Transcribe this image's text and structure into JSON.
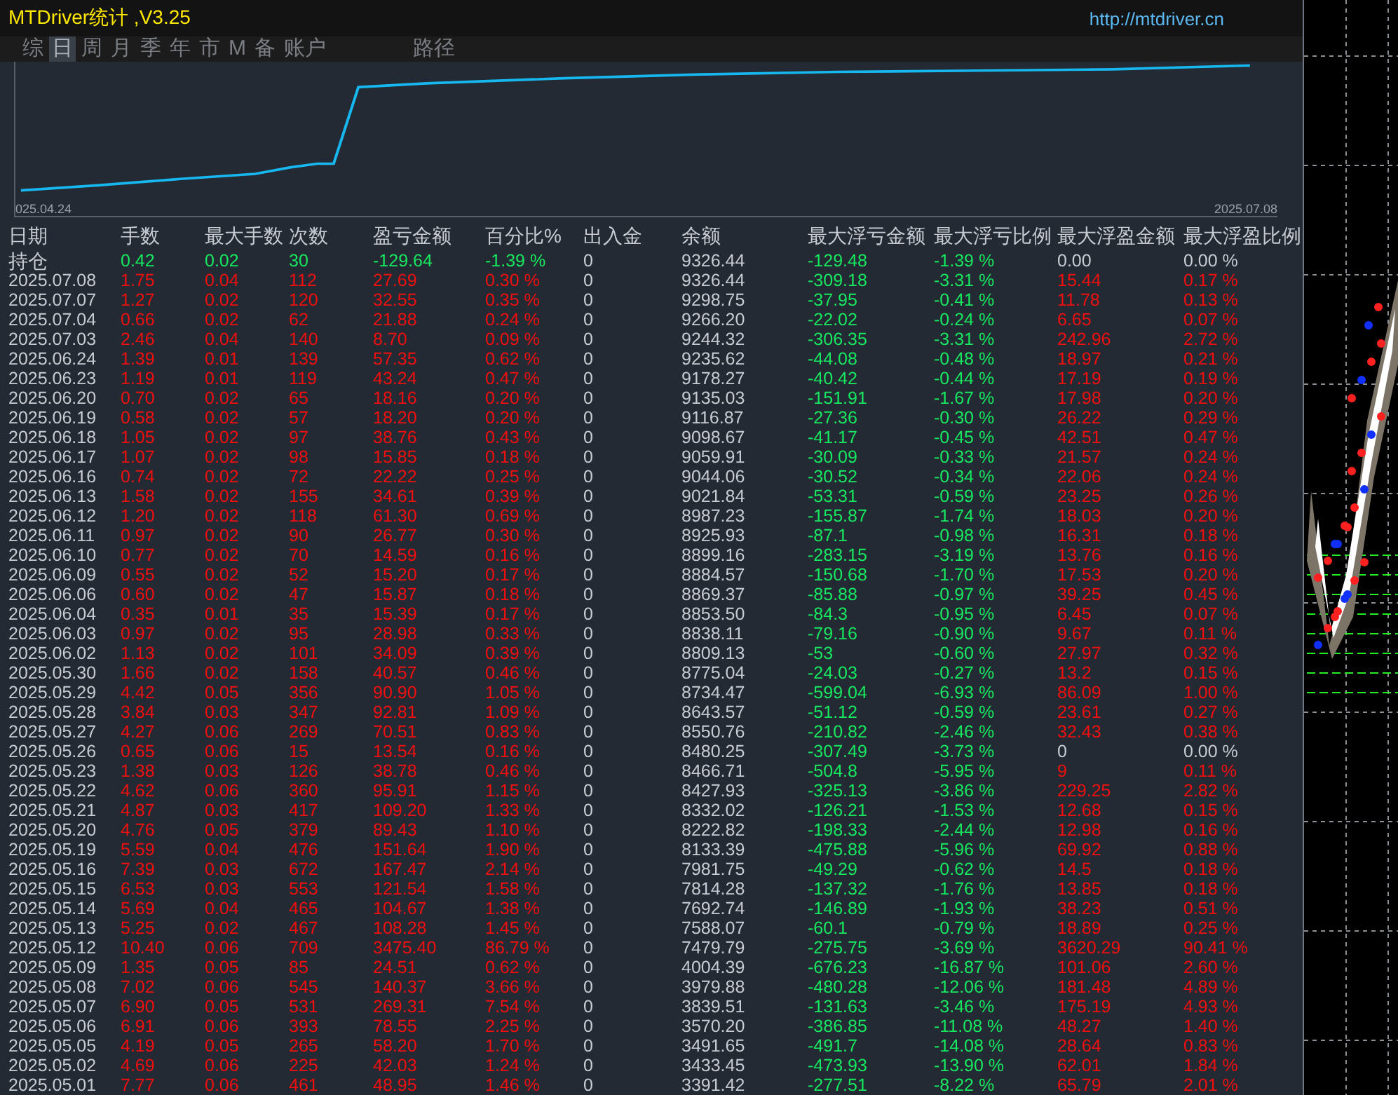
{
  "title": "MTDriver统计 ,V3.25",
  "url": "http://mtdriver.cn",
  "tabs": [
    {
      "label": "综",
      "selected": false
    },
    {
      "label": "日",
      "selected": true
    },
    {
      "label": "周",
      "selected": false
    },
    {
      "label": "月",
      "selected": false
    },
    {
      "label": "季",
      "selected": false
    },
    {
      "label": "年",
      "selected": false
    },
    {
      "label": "市",
      "selected": false
    },
    {
      "label": "M",
      "selected": false
    },
    {
      "label": "备",
      "selected": false
    },
    {
      "label": "账户",
      "selected": false
    },
    {
      "label": "路径",
      "selected": false
    }
  ],
  "equity_chart": {
    "start_label": "025.04.24",
    "end_label": "2025.07.08"
  },
  "columns": [
    "日期",
    "手数",
    "最大手数",
    "次数",
    "盈亏金额",
    "百分比%",
    "出入金",
    "余额",
    "最大浮亏金额",
    "最大浮亏比例",
    "最大浮盈金额",
    "最大浮盈比例"
  ],
  "rows": [
    {
      "kind": "holding",
      "date": "持仓",
      "values": [
        "0.42",
        "0.02",
        "30",
        "-129.64",
        "-1.39 %",
        "0",
        "9326.44",
        "-129.48",
        "-1.39 %",
        "0.00",
        "0.00 %"
      ],
      "zero_float_profit": true
    },
    {
      "kind": "day",
      "date": "2025.07.08",
      "values": [
        "1.75",
        "0.04",
        "112",
        "27.69",
        "0.30 %",
        "0",
        "9326.44",
        "-309.18",
        "-3.31 %",
        "15.44",
        "0.17 %"
      ],
      "zero_float_profit": false
    },
    {
      "kind": "day",
      "date": "2025.07.07",
      "values": [
        "1.27",
        "0.02",
        "120",
        "32.55",
        "0.35 %",
        "0",
        "9298.75",
        "-37.95",
        "-0.41 %",
        "11.78",
        "0.13 %"
      ],
      "zero_float_profit": false
    },
    {
      "kind": "day",
      "date": "2025.07.04",
      "values": [
        "0.66",
        "0.02",
        "62",
        "21.88",
        "0.24 %",
        "0",
        "9266.20",
        "-22.02",
        "-0.24 %",
        "6.65",
        "0.07 %"
      ],
      "zero_float_profit": false
    },
    {
      "kind": "day",
      "date": "2025.07.03",
      "values": [
        "2.46",
        "0.04",
        "140",
        "8.70",
        "0.09 %",
        "0",
        "9244.32",
        "-306.35",
        "-3.31 %",
        "242.96",
        "2.72 %"
      ],
      "zero_float_profit": false
    },
    {
      "kind": "day",
      "date": "2025.06.24",
      "values": [
        "1.39",
        "0.01",
        "139",
        "57.35",
        "0.62 %",
        "0",
        "9235.62",
        "-44.08",
        "-0.48 %",
        "18.97",
        "0.21 %"
      ],
      "zero_float_profit": false
    },
    {
      "kind": "day",
      "date": "2025.06.23",
      "values": [
        "1.19",
        "0.01",
        "119",
        "43.24",
        "0.47 %",
        "0",
        "9178.27",
        "-40.42",
        "-0.44 %",
        "17.19",
        "0.19 %"
      ],
      "zero_float_profit": false
    },
    {
      "kind": "day",
      "date": "2025.06.20",
      "values": [
        "0.70",
        "0.02",
        "65",
        "18.16",
        "0.20 %",
        "0",
        "9135.03",
        "-151.91",
        "-1.67 %",
        "17.98",
        "0.20 %"
      ],
      "zero_float_profit": false
    },
    {
      "kind": "day",
      "date": "2025.06.19",
      "values": [
        "0.58",
        "0.02",
        "57",
        "18.20",
        "0.20 %",
        "0",
        "9116.87",
        "-27.36",
        "-0.30 %",
        "26.22",
        "0.29 %"
      ],
      "zero_float_profit": false
    },
    {
      "kind": "day",
      "date": "2025.06.18",
      "values": [
        "1.05",
        "0.02",
        "97",
        "38.76",
        "0.43 %",
        "0",
        "9098.67",
        "-41.17",
        "-0.45 %",
        "42.51",
        "0.47 %"
      ],
      "zero_float_profit": false
    },
    {
      "kind": "day",
      "date": "2025.06.17",
      "values": [
        "1.07",
        "0.02",
        "98",
        "15.85",
        "0.18 %",
        "0",
        "9059.91",
        "-30.09",
        "-0.33 %",
        "21.57",
        "0.24 %"
      ],
      "zero_float_profit": false
    },
    {
      "kind": "day",
      "date": "2025.06.16",
      "values": [
        "0.74",
        "0.02",
        "72",
        "22.22",
        "0.25 %",
        "0",
        "9044.06",
        "-30.52",
        "-0.34 %",
        "22.06",
        "0.24 %"
      ],
      "zero_float_profit": false
    },
    {
      "kind": "day",
      "date": "2025.06.13",
      "values": [
        "1.58",
        "0.02",
        "155",
        "34.61",
        "0.39 %",
        "0",
        "9021.84",
        "-53.31",
        "-0.59 %",
        "23.25",
        "0.26 %"
      ],
      "zero_float_profit": false
    },
    {
      "kind": "day",
      "date": "2025.06.12",
      "values": [
        "1.20",
        "0.02",
        "118",
        "61.30",
        "0.69 %",
        "0",
        "8987.23",
        "-155.87",
        "-1.74 %",
        "18.03",
        "0.20 %"
      ],
      "zero_float_profit": false
    },
    {
      "kind": "day",
      "date": "2025.06.11",
      "values": [
        "0.97",
        "0.02",
        "90",
        "26.77",
        "0.30 %",
        "0",
        "8925.93",
        "-87.1",
        "-0.98 %",
        "16.31",
        "0.18 %"
      ],
      "zero_float_profit": false
    },
    {
      "kind": "day",
      "date": "2025.06.10",
      "values": [
        "0.77",
        "0.02",
        "70",
        "14.59",
        "0.16 %",
        "0",
        "8899.16",
        "-283.15",
        "-3.19 %",
        "13.76",
        "0.16 %"
      ],
      "zero_float_profit": false
    },
    {
      "kind": "day",
      "date": "2025.06.09",
      "values": [
        "0.55",
        "0.02",
        "52",
        "15.20",
        "0.17 %",
        "0",
        "8884.57",
        "-150.68",
        "-1.70 %",
        "17.53",
        "0.20 %"
      ],
      "zero_float_profit": false
    },
    {
      "kind": "day",
      "date": "2025.06.06",
      "values": [
        "0.60",
        "0.02",
        "47",
        "15.87",
        "0.18 %",
        "0",
        "8869.37",
        "-85.88",
        "-0.97 %",
        "39.25",
        "0.45 %"
      ],
      "zero_float_profit": false
    },
    {
      "kind": "day",
      "date": "2025.06.04",
      "values": [
        "0.35",
        "0.01",
        "35",
        "15.39",
        "0.17 %",
        "0",
        "8853.50",
        "-84.3",
        "-0.95 %",
        "6.45",
        "0.07 %"
      ],
      "zero_float_profit": false
    },
    {
      "kind": "day",
      "date": "2025.06.03",
      "values": [
        "0.97",
        "0.02",
        "95",
        "28.98",
        "0.33 %",
        "0",
        "8838.11",
        "-79.16",
        "-0.90 %",
        "9.67",
        "0.11 %"
      ],
      "zero_float_profit": false
    },
    {
      "kind": "day",
      "date": "2025.06.02",
      "values": [
        "1.13",
        "0.02",
        "101",
        "34.09",
        "0.39 %",
        "0",
        "8809.13",
        "-53",
        "-0.60 %",
        "27.97",
        "0.32 %"
      ],
      "zero_float_profit": false
    },
    {
      "kind": "day",
      "date": "2025.05.30",
      "values": [
        "1.66",
        "0.02",
        "158",
        "40.57",
        "0.46 %",
        "0",
        "8775.04",
        "-24.03",
        "-0.27 %",
        "13.2",
        "0.15 %"
      ],
      "zero_float_profit": false
    },
    {
      "kind": "day",
      "date": "2025.05.29",
      "values": [
        "4.42",
        "0.05",
        "356",
        "90.90",
        "1.05 %",
        "0",
        "8734.47",
        "-599.04",
        "-6.93 %",
        "86.09",
        "1.00 %"
      ],
      "zero_float_profit": false
    },
    {
      "kind": "day",
      "date": "2025.05.28",
      "values": [
        "3.84",
        "0.03",
        "347",
        "92.81",
        "1.09 %",
        "0",
        "8643.57",
        "-51.12",
        "-0.59 %",
        "23.61",
        "0.27 %"
      ],
      "zero_float_profit": false
    },
    {
      "kind": "day",
      "date": "2025.05.27",
      "values": [
        "4.27",
        "0.06",
        "269",
        "70.51",
        "0.83 %",
        "0",
        "8550.76",
        "-210.82",
        "-2.46 %",
        "32.43",
        "0.38 %"
      ],
      "zero_float_profit": false
    },
    {
      "kind": "day",
      "date": "2025.05.26",
      "values": [
        "0.65",
        "0.06",
        "15",
        "13.54",
        "0.16 %",
        "0",
        "8480.25",
        "-307.49",
        "-3.73 %",
        "0",
        "0.00 %"
      ],
      "zero_float_profit": true
    },
    {
      "kind": "day",
      "date": "2025.05.23",
      "values": [
        "1.38",
        "0.03",
        "126",
        "38.78",
        "0.46 %",
        "0",
        "8466.71",
        "-504.8",
        "-5.95 %",
        "9",
        "0.11 %"
      ],
      "zero_float_profit": false
    },
    {
      "kind": "day",
      "date": "2025.05.22",
      "values": [
        "4.62",
        "0.06",
        "360",
        "95.91",
        "1.15 %",
        "0",
        "8427.93",
        "-325.13",
        "-3.86 %",
        "229.25",
        "2.82 %"
      ],
      "zero_float_profit": false
    },
    {
      "kind": "day",
      "date": "2025.05.21",
      "values": [
        "4.87",
        "0.03",
        "417",
        "109.20",
        "1.33 %",
        "0",
        "8332.02",
        "-126.21",
        "-1.53 %",
        "12.68",
        "0.15 %"
      ],
      "zero_float_profit": false
    },
    {
      "kind": "day",
      "date": "2025.05.20",
      "values": [
        "4.76",
        "0.05",
        "379",
        "89.43",
        "1.10 %",
        "0",
        "8222.82",
        "-198.33",
        "-2.44 %",
        "12.98",
        "0.16 %"
      ],
      "zero_float_profit": false
    },
    {
      "kind": "day",
      "date": "2025.05.19",
      "values": [
        "5.59",
        "0.04",
        "476",
        "151.64",
        "1.90 %",
        "0",
        "8133.39",
        "-475.88",
        "-5.96 %",
        "69.92",
        "0.88 %"
      ],
      "zero_float_profit": false
    },
    {
      "kind": "day",
      "date": "2025.05.16",
      "values": [
        "7.39",
        "0.03",
        "672",
        "167.47",
        "2.14 %",
        "0",
        "7981.75",
        "-49.29",
        "-0.62 %",
        "14.5",
        "0.18 %"
      ],
      "zero_float_profit": false
    },
    {
      "kind": "day",
      "date": "2025.05.15",
      "values": [
        "6.53",
        "0.03",
        "553",
        "121.54",
        "1.58 %",
        "0",
        "7814.28",
        "-137.32",
        "-1.76 %",
        "13.85",
        "0.18 %"
      ],
      "zero_float_profit": false
    },
    {
      "kind": "day",
      "date": "2025.05.14",
      "values": [
        "5.69",
        "0.04",
        "465",
        "104.67",
        "1.38 %",
        "0",
        "7692.74",
        "-146.89",
        "-1.93 %",
        "38.23",
        "0.51 %"
      ],
      "zero_float_profit": false
    },
    {
      "kind": "day",
      "date": "2025.05.13",
      "values": [
        "5.25",
        "0.02",
        "467",
        "108.28",
        "1.45 %",
        "0",
        "7588.07",
        "-60.1",
        "-0.79 %",
        "18.89",
        "0.25 %"
      ],
      "zero_float_profit": false
    },
    {
      "kind": "day",
      "date": "2025.05.12",
      "values": [
        "10.40",
        "0.06",
        "709",
        "3475.40",
        "86.79 %",
        "0",
        "7479.79",
        "-275.75",
        "-3.69 %",
        "3620.29",
        "90.41 %"
      ],
      "zero_float_profit": false
    },
    {
      "kind": "day",
      "date": "2025.05.09",
      "values": [
        "1.35",
        "0.05",
        "85",
        "24.51",
        "0.62 %",
        "0",
        "4004.39",
        "-676.23",
        "-16.87 %",
        "101.06",
        "2.60 %"
      ],
      "zero_float_profit": false
    },
    {
      "kind": "day",
      "date": "2025.05.08",
      "values": [
        "7.02",
        "0.06",
        "545",
        "140.37",
        "3.66 %",
        "0",
        "3979.88",
        "-480.28",
        "-12.06 %",
        "181.48",
        "4.89 %"
      ],
      "zero_float_profit": false
    },
    {
      "kind": "day",
      "date": "2025.05.07",
      "values": [
        "6.90",
        "0.05",
        "531",
        "269.31",
        "7.54 %",
        "0",
        "3839.51",
        "-131.63",
        "-3.46 %",
        "175.19",
        "4.93 %"
      ],
      "zero_float_profit": false
    },
    {
      "kind": "day",
      "date": "2025.05.06",
      "values": [
        "6.91",
        "0.06",
        "393",
        "78.55",
        "2.25 %",
        "0",
        "3570.20",
        "-386.85",
        "-11.08 %",
        "48.27",
        "1.40 %"
      ],
      "zero_float_profit": false
    },
    {
      "kind": "day",
      "date": "2025.05.05",
      "values": [
        "4.19",
        "0.05",
        "265",
        "58.20",
        "1.70 %",
        "0",
        "3491.65",
        "-491.7",
        "-14.08 %",
        "28.64",
        "0.83 %"
      ],
      "zero_float_profit": false
    },
    {
      "kind": "day",
      "date": "2025.05.02",
      "values": [
        "4.69",
        "0.06",
        "225",
        "42.03",
        "1.24 %",
        "0",
        "3433.45",
        "-473.93",
        "-13.90 %",
        "62.01",
        "1.84 %"
      ],
      "zero_float_profit": false
    },
    {
      "kind": "day",
      "date": "2025.05.01",
      "values": [
        "7.77",
        "0.06",
        "461",
        "48.95",
        "1.46 %",
        "0",
        "3391.42",
        "-277.51",
        "-8.22 %",
        "65.79",
        "2.01 %"
      ],
      "zero_float_profit": false
    }
  ]
}
